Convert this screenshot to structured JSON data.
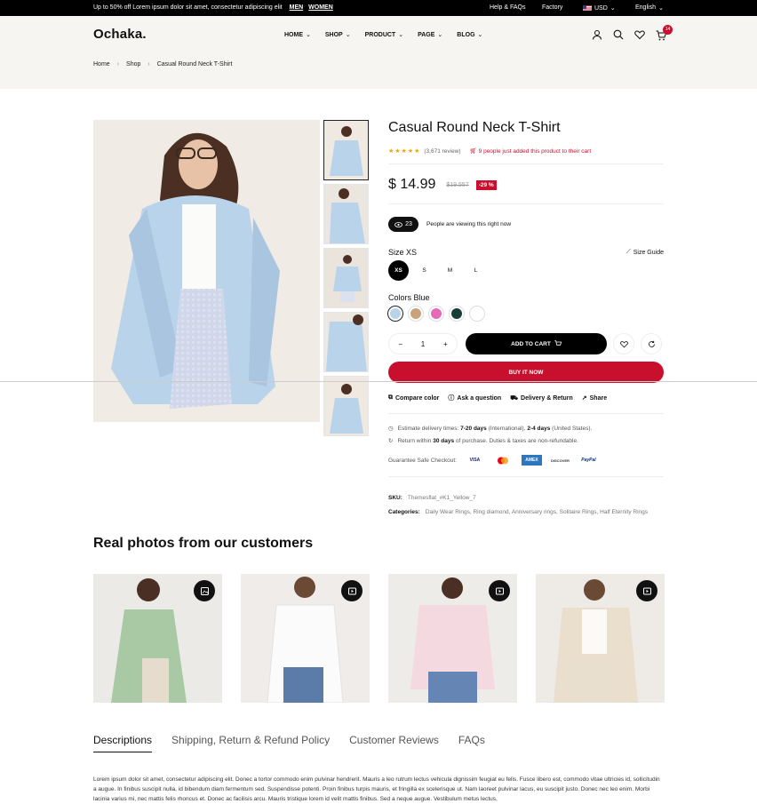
{
  "topbar": {
    "promo": "Up to 50% off Lorem ipsum dolor sit amet, consectetur adipiscing elit",
    "men": "MEN",
    "women": "WOMEN",
    "help": "Help & FAQs",
    "factory": "Factory",
    "currency": "USD",
    "language": "English"
  },
  "header": {
    "logo": "Ochaka.",
    "nav": [
      "HOME",
      "SHOP",
      "PRODUCT",
      "PAGE",
      "BLOG"
    ],
    "cart_count": "14"
  },
  "breadcrumb": [
    "Home",
    "Shop",
    "Casual Round Neck T-Shirt"
  ],
  "product": {
    "title": "Casual Round Neck T-Shirt",
    "stars": "★★★★★",
    "reviews": "(3,671 review)",
    "cart_note": "9 people just added this product to their cart",
    "price": "$ 14.99",
    "old_price": "$19.557",
    "discount": "-29 %",
    "viewers": "23",
    "viewing_text": "People are viewing this right now",
    "size_label": "Size XS",
    "size_guide": "Size Guide",
    "sizes": [
      "XS",
      "S",
      "M",
      "L"
    ],
    "color_label": "Colors Blue",
    "colors": [
      "#b9d3ea",
      "#c9a27e",
      "#e56bb8",
      "#173f35",
      "#ffffff"
    ],
    "qty": "1",
    "add_to_cart": "ADD TO CART",
    "buy_now": "BUY IT NOW",
    "extras": [
      "Compare color",
      "Ask a question",
      "Delivery & Return",
      "Share"
    ],
    "delivery_pre": "Estimate delivery times:",
    "delivery_d1": "7-20 days",
    "delivery_mid": "(International),",
    "delivery_d2": "2-4 days",
    "delivery_post": "(United States).",
    "return_pre": "Return within",
    "return_days": "30 days",
    "return_post": "of purchase. Duties & taxes are non-refundable.",
    "checkout_label": "Guarantee Safe Checkout:",
    "cards": [
      "VISA",
      "MC",
      "AMEX",
      "DISCOVER",
      "PayPal"
    ],
    "sku_label": "SKU:",
    "sku": "Themesflat_#K1_Yellow_7",
    "categories_label": "Categories:",
    "categories": "Daily Wear Rings, Ring diamond, Anniversary rings, Solitaire Rings, Half Eternity Rings"
  },
  "real_photos": {
    "heading": "Real photos from our customers",
    "items": [
      {
        "shirt": "#a9c8a4",
        "bg": "#eceae6"
      },
      {
        "shirt": "#fbfbfb",
        "bg": "#efecea"
      },
      {
        "shirt": "#f5d9e0",
        "bg": "#eeece9"
      },
      {
        "shirt": "#eadfcc",
        "bg": "#eeebe6"
      }
    ]
  },
  "tabs": [
    "Descriptions",
    "Shipping, Return & Refund Policy",
    "Customer Reviews",
    "FAQs"
  ],
  "description": "Lorem ipsum dolor sit amet, consectetur adipiscing elit. Donec a tortor commodo enim pulvinar hendrerit. Mauris a leo rutrum lectus vehicula dignissim feugiat eu felis. Fusce libero est, commodo vitae ultricies id, sollicitudin a augue. In finibus suscipit nulla, id bibendum diam fermentum sed. Suspendisse potenti. Proin finibus turpis mauris, et fringilla ex scelerisque ut. Nam laoreet pulvinar lacus, eu suscipit justo. Donec nec leo enim. Morbi lacinia varius mi, nec mattis felis rhoncus et. Donec ac facilisis arcu. Mauris tristique lorem id velit mattis finibus. Sed a neque augue. Vestibulum metus lectus,"
}
